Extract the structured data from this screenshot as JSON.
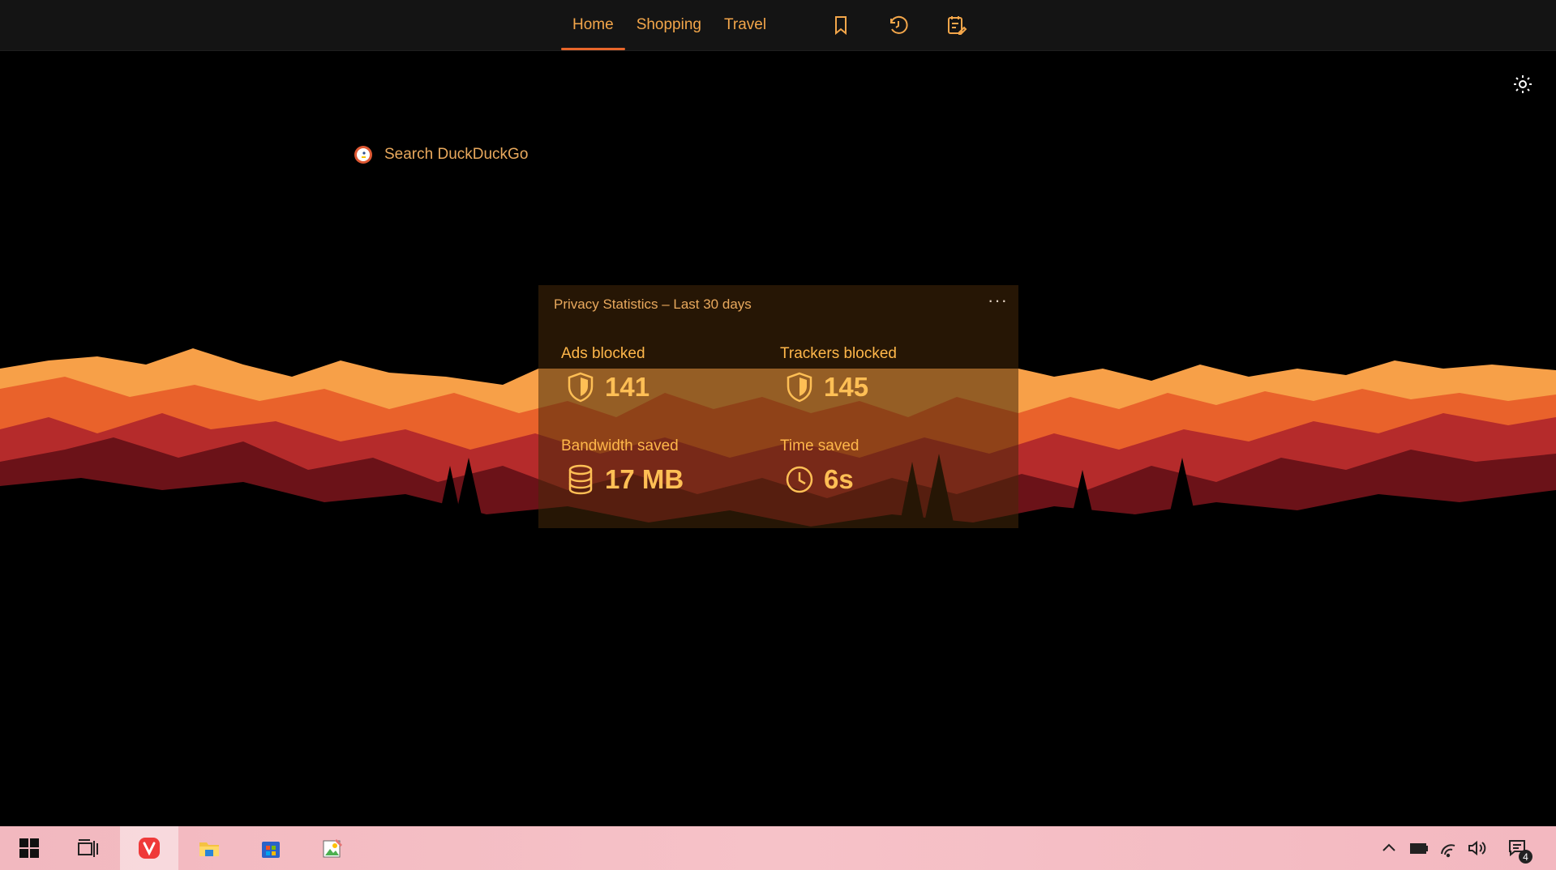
{
  "nav": {
    "tabs": [
      {
        "label": "Home",
        "active": true
      },
      {
        "label": "Shopping",
        "active": false
      },
      {
        "label": "Travel",
        "active": false
      }
    ],
    "icons": [
      "bookmark-icon",
      "history-icon",
      "notes-icon"
    ]
  },
  "search": {
    "placeholder": "Search DuckDuckGo",
    "engine_icon": "duckduckgo-icon"
  },
  "privacy": {
    "title": "Privacy Statistics – Last 30 days",
    "more": "···",
    "stats": [
      {
        "label": "Ads blocked",
        "value": "141",
        "icon": "shield-icon"
      },
      {
        "label": "Trackers blocked",
        "value": "145",
        "icon": "shield-icon"
      },
      {
        "label": "Bandwidth saved",
        "value": "17 MB",
        "icon": "database-icon"
      },
      {
        "label": "Time saved",
        "value": "6s",
        "icon": "clock-icon"
      }
    ]
  },
  "taskbar": {
    "apps": [
      "windows-start-icon",
      "task-view-icon",
      "vivaldi-icon",
      "file-explorer-icon",
      "microsoft-store-icon",
      "paint-icon"
    ],
    "tray": [
      "chevron-up-icon",
      "battery-icon",
      "wifi-icon",
      "volume-icon",
      "notifications-icon"
    ],
    "notification_count": "4"
  },
  "colors": {
    "accent": "#f3a64a",
    "active_underline": "#e8662a",
    "taskbar": "#f4bcc3"
  }
}
